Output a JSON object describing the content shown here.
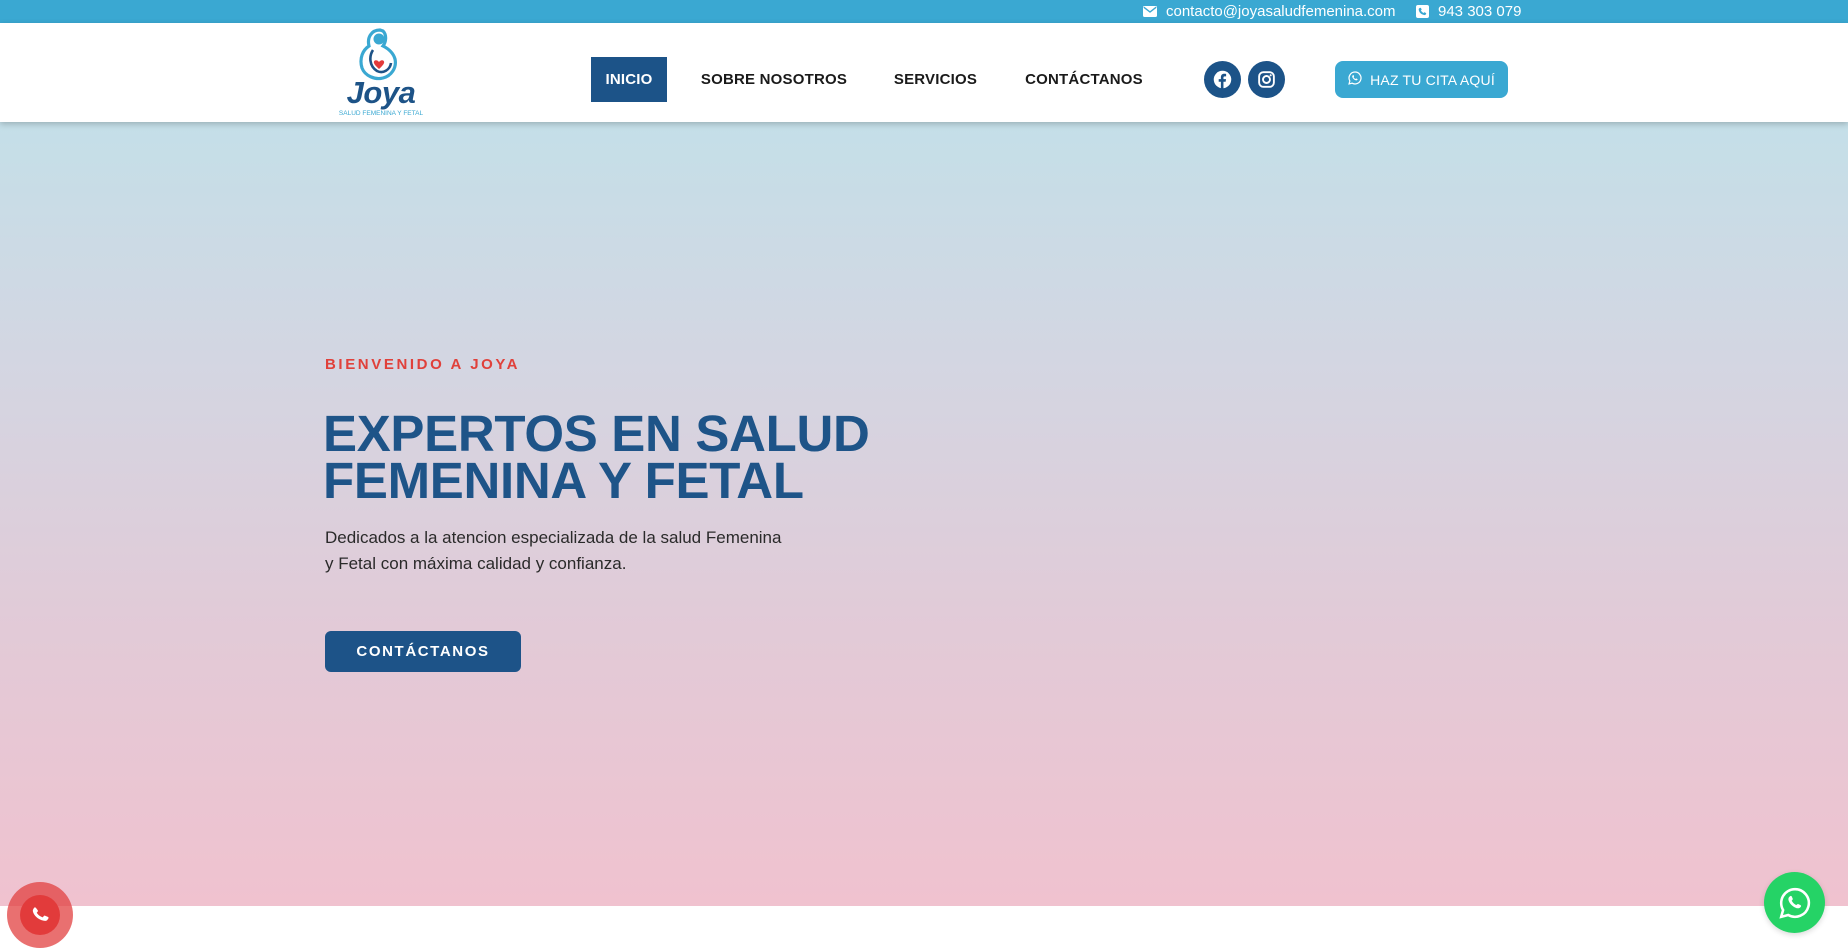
{
  "topbar": {
    "email": "contacto@joyasaludfemenina.com",
    "phone": "943 303 079"
  },
  "logo": {
    "brand": "Joya",
    "tagline": "SALUD FEMENINA Y FETAL"
  },
  "nav": {
    "items": [
      {
        "label": "INICIO",
        "active": true
      },
      {
        "label": "SOBRE NOSOTROS",
        "active": false
      },
      {
        "label": "SERVICIOS",
        "active": false
      },
      {
        "label": "CONTÁCTANOS",
        "active": false
      }
    ]
  },
  "social": {
    "icons": [
      "facebook-icon",
      "instagram-icon"
    ]
  },
  "header_cta": {
    "label": "HAZ TU CITA AQUÍ",
    "icon": "whatsapp-icon"
  },
  "hero": {
    "eyebrow": "BIENVENIDO A JOYA",
    "headline_line1": "EXPERTOS EN SALUD",
    "headline_line2": "FEMENINA Y FETAL",
    "description_line1": "Dedicados a la atencion especializada de la salud Femenina",
    "description_line2": "y Fetal con máxima calidad y confianza.",
    "cta_label": "CONTÁCTANOS"
  },
  "colors": {
    "topbar": "#3aa8d2",
    "primary": "#1c5388",
    "accent_red": "#e0413b",
    "whatsapp": "#25d366"
  }
}
